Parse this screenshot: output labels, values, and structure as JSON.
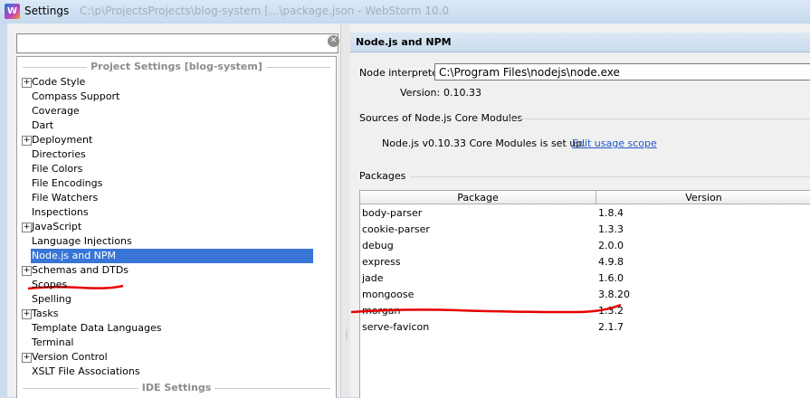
{
  "window": {
    "title": "Settings",
    "path_text": "C:\\p\\ProjectsProjects\\blog-system [...\\package.json - WebStorm 10.0"
  },
  "left_panel": {
    "search_placeholder": "",
    "project_section": "Project Settings [blog-system]",
    "ide_section": "IDE Settings",
    "items": [
      {
        "label": "Code Style",
        "expandable": true
      },
      {
        "label": "Compass Support",
        "expandable": false
      },
      {
        "label": "Coverage",
        "expandable": false
      },
      {
        "label": "Dart",
        "expandable": false
      },
      {
        "label": "Deployment",
        "expandable": true
      },
      {
        "label": "Directories",
        "expandable": false
      },
      {
        "label": "File Colors",
        "expandable": false
      },
      {
        "label": "File Encodings",
        "expandable": false
      },
      {
        "label": "File Watchers",
        "expandable": false
      },
      {
        "label": "Inspections",
        "expandable": false
      },
      {
        "label": "JavaScript",
        "expandable": true
      },
      {
        "label": "Language Injections",
        "expandable": false
      },
      {
        "label": "Node.js and NPM",
        "expandable": false,
        "selected": true
      },
      {
        "label": "Schemas and DTDs",
        "expandable": true
      },
      {
        "label": "Scopes",
        "expandable": false
      },
      {
        "label": "Spelling",
        "expandable": false
      },
      {
        "label": "Tasks",
        "expandable": true
      },
      {
        "label": "Template Data Languages",
        "expandable": false
      },
      {
        "label": "Terminal",
        "expandable": false
      },
      {
        "label": "Version Control",
        "expandable": true
      },
      {
        "label": "XSLT File Associations",
        "expandable": false
      }
    ]
  },
  "right_panel": {
    "header": "Node.js and NPM",
    "interpreter_label": "Node interpreter:",
    "interpreter_value": "C:\\Program Files\\nodejs\\node.exe",
    "version_label": "Version:",
    "version_value": "0.10.33",
    "core_modules_title": "Sources of Node.js Core Modules",
    "core_modules_status": "Node.js v0.10.33 Core Modules is set up.",
    "edit_scope_link": "Edit usage scope",
    "packages_title": "Packages",
    "columns": [
      "Package",
      "Version"
    ],
    "packages": [
      {
        "name": "body-parser",
        "version": "1.8.4"
      },
      {
        "name": "cookie-parser",
        "version": "1.3.3"
      },
      {
        "name": "debug",
        "version": "2.0.0"
      },
      {
        "name": "express",
        "version": "4.9.8"
      },
      {
        "name": "jade",
        "version": "1.6.0"
      },
      {
        "name": "mongoose",
        "version": "3.8.20"
      },
      {
        "name": "morgan",
        "version": "1.3.2"
      },
      {
        "name": "serve-favicon",
        "version": "2.1.7"
      }
    ]
  },
  "colors": {
    "selection": "#3875d7",
    "link": "#2258c9",
    "annotation": "#e60000"
  },
  "icons": [
    "webstorm-app-icon",
    "clear-search-icon",
    "expand-plus-icon",
    "splitter-grip-icon"
  ]
}
